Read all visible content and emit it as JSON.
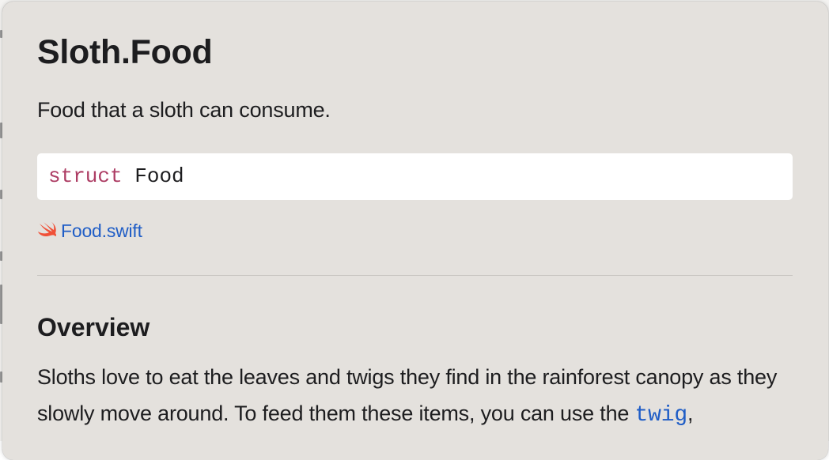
{
  "popover": {
    "title": "Sloth.Food",
    "abstract": "Food that a sloth can consume.",
    "declaration": {
      "keyword": "struct",
      "type_name": "Food"
    },
    "source_file": {
      "icon": "swift-icon",
      "label": "Food.swift"
    },
    "overview": {
      "heading": "Overview",
      "text_before": "Sloths love to eat the leaves and twigs they find in the rainforest canopy as they slowly move around. To feed them these items, you can use the ",
      "link_twig": "twig",
      "text_after": ","
    }
  },
  "colors": {
    "popover_background": "#e4e1dd",
    "keyword": "#ad3d64",
    "link": "#1f5dc6",
    "swift_orange": "#f05138"
  }
}
